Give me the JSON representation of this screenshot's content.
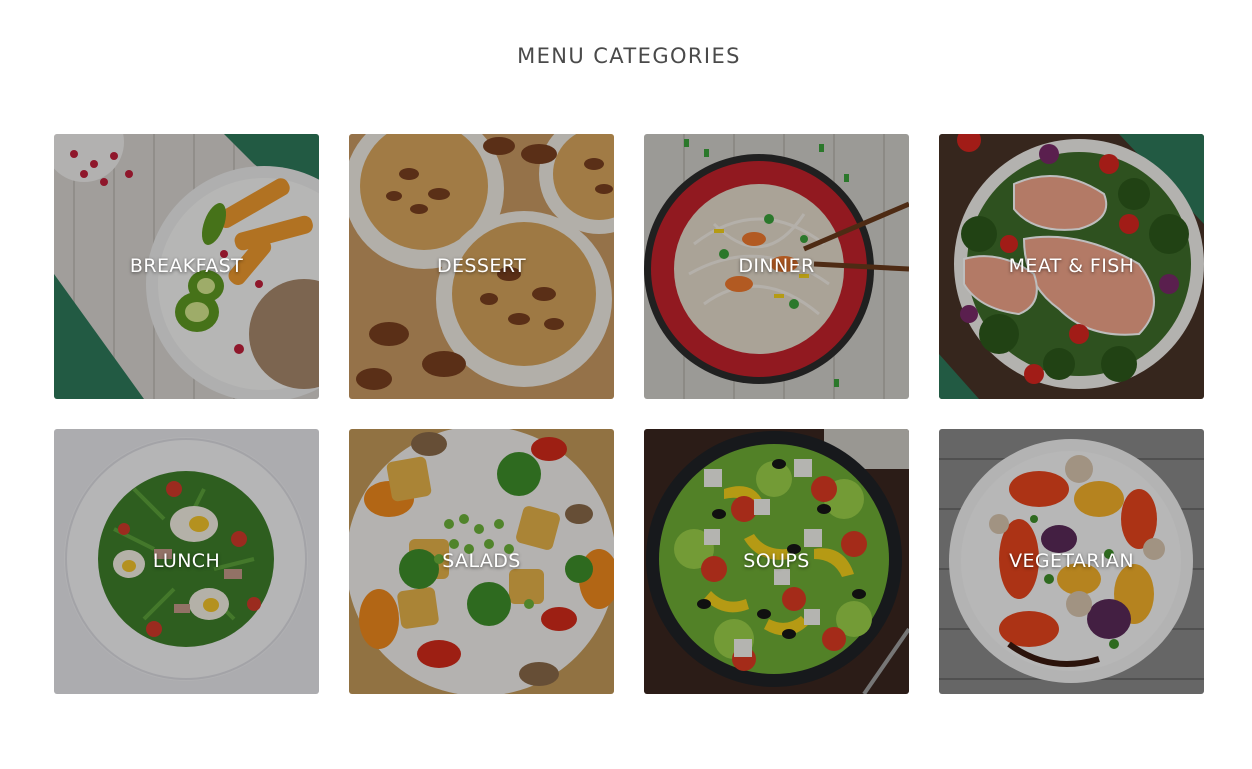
{
  "section": {
    "title": "MENU CATEGORIES"
  },
  "categories": [
    {
      "label": "BREAKFAST",
      "image": "breakfast-bowl-photo"
    },
    {
      "label": "DESSERT",
      "image": "pecan-muffins-photo"
    },
    {
      "label": "DINNER",
      "image": "noodle-bowl-photo"
    },
    {
      "label": "MEAT & FISH",
      "image": "salmon-dish-photo"
    },
    {
      "label": "LUNCH",
      "image": "salad-plate-photo"
    },
    {
      "label": "SALADS",
      "image": "tofu-vegetable-salad-photo"
    },
    {
      "label": "SOUPS",
      "image": "greek-salad-bowl-photo"
    },
    {
      "label": "VEGETARIAN",
      "image": "roasted-vegetables-photo"
    }
  ]
}
